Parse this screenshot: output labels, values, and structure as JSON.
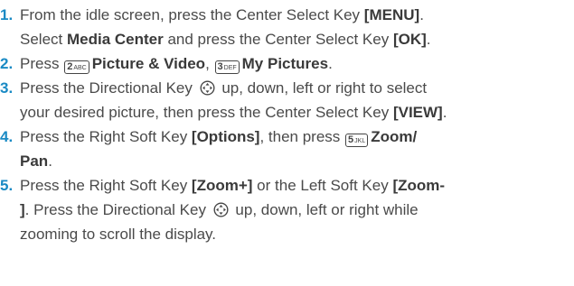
{
  "steps": [
    {
      "number": "1.",
      "lines": [
        {
          "pre": "From the idle screen, press the Center Select Key ",
          "bold": "[MENU]",
          "post": "."
        },
        {
          "pre": "Select ",
          "bold": "Media Center",
          "mid": " and press the Center Select Key ",
          "bold2": "[OK]",
          "post": "."
        }
      ]
    },
    {
      "number": "2.",
      "text_press": "Press ",
      "key1": {
        "digit": "2",
        "letters": "ABC"
      },
      "item1": "Picture & Video",
      "sep": ", ",
      "key2": {
        "digit": "3",
        "letters": "DEF"
      },
      "item2": "My Pictures",
      "end": "."
    },
    {
      "number": "3.",
      "l1_pre": "Press the Directional Key ",
      "l1_post": " up, down, left or right to select",
      "l2_pre": "your desired picture, then press the Center Select Key ",
      "l2_bold": "[VIEW]",
      "l2_post": "."
    },
    {
      "number": "4.",
      "l1_pre": "Press the Right Soft Key ",
      "l1_bold": "[Options]",
      "l1_mid": ", then press ",
      "key": {
        "digit": "5",
        "letters": "JKL"
      },
      "l1_bold2": "Zoom/",
      "l2_bold": "Pan",
      "l2_post": "."
    },
    {
      "number": "5.",
      "l1_pre": "Press the Right Soft Key ",
      "l1_bold": "[Zoom+]",
      "l1_mid": " or the Left Soft Key ",
      "l1_bold2": "[Zoom-",
      "l2_bold": "]",
      "l2_mid": ". Press the Directional Key ",
      "l2_post": " up, down, left or right while",
      "l3": "zooming to scroll the display."
    }
  ],
  "colors": {
    "number": "#1a8ac4",
    "text": "#4a4a4a"
  }
}
